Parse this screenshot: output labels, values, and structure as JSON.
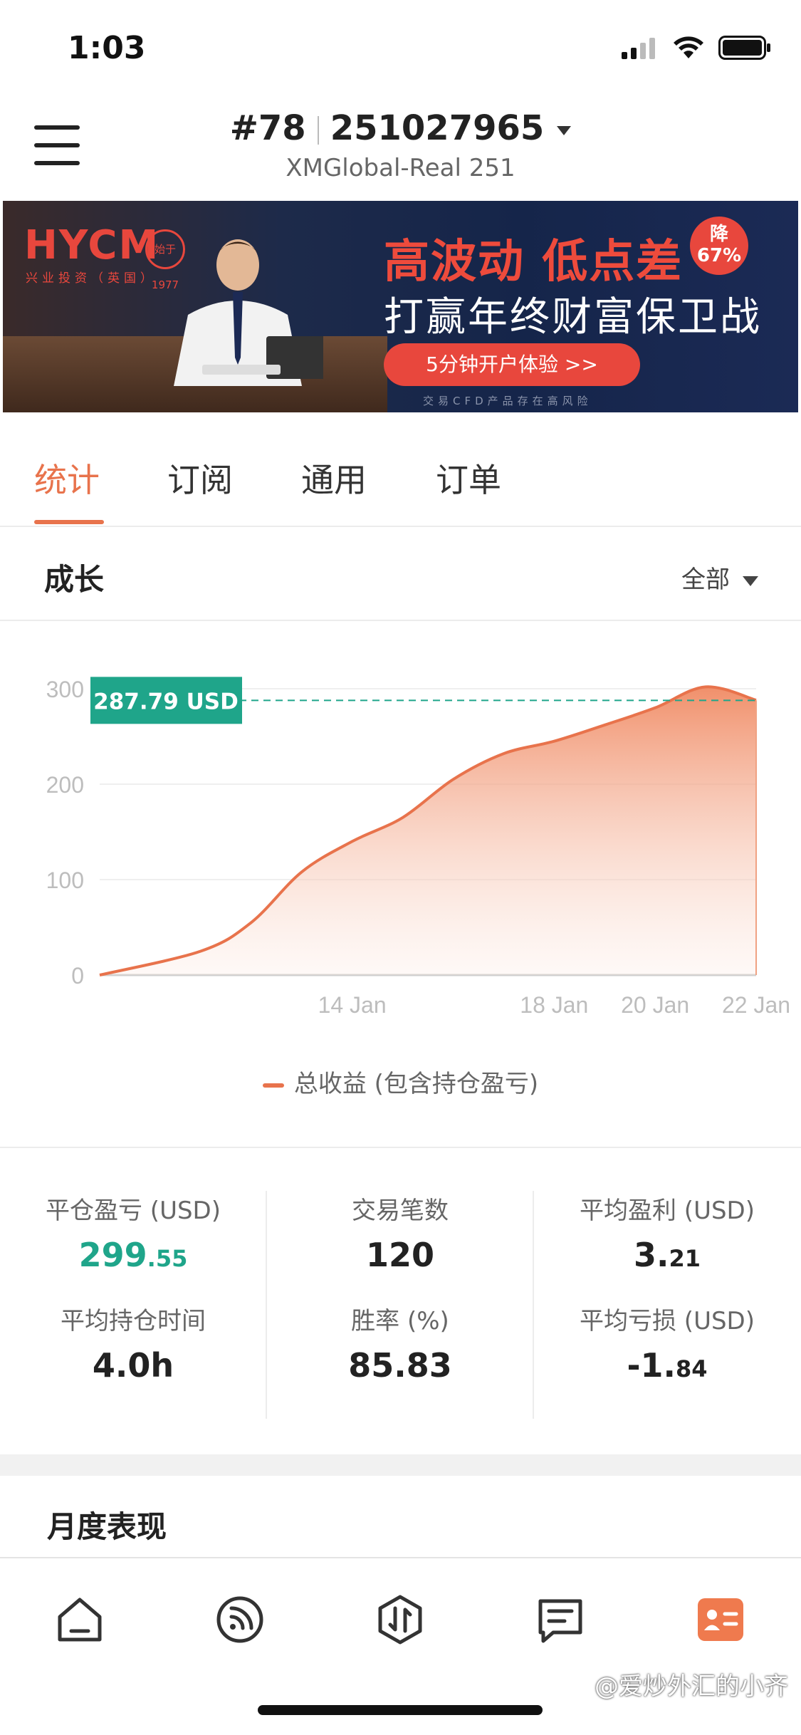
{
  "status_bar": {
    "time": "1:03"
  },
  "header": {
    "account_rank": "#78",
    "account_number": "251027965",
    "server": "XMGlobal-Real 251"
  },
  "banner": {
    "logo": "HYCM",
    "logo_sub": "兴业投资（英国）",
    "seal": "始于1977",
    "headline": "高波动 低点差",
    "subline": "打赢年终财富保卫战",
    "badge_line1": "降",
    "badge_line2": "67%",
    "cta": "5分钟开户体验 >>",
    "disclaimer": "交易CFD产品存在高风险"
  },
  "tabs": [
    {
      "label": "统计",
      "active": true
    },
    {
      "label": "订阅",
      "active": false
    },
    {
      "label": "通用",
      "active": false
    },
    {
      "label": "订单",
      "active": false
    }
  ],
  "growth": {
    "title": "成长",
    "range_filter": "全部"
  },
  "chart_data": {
    "type": "area",
    "x": [
      "2020-01-09",
      "2020-01-11",
      "2020-01-12",
      "2020-01-13",
      "2020-01-14",
      "2020-01-15",
      "2020-01-16",
      "2020-01-17",
      "2020-01-18",
      "2020-01-19",
      "2020-01-20",
      "2020-01-21",
      "2020-01-22"
    ],
    "series": [
      {
        "name": "总收益 (包含持仓盈亏)",
        "values": [
          0,
          25,
          55,
          108,
          140,
          165,
          205,
          232,
          245,
          262,
          280,
          302,
          288
        ]
      }
    ],
    "xticks": [
      "14 Jan",
      "18 Jan",
      "20 Jan",
      "22 Jan"
    ],
    "yticks": [
      0,
      100,
      200,
      300
    ],
    "ylim": [
      0,
      300
    ],
    "current_value_label": "287.79 USD",
    "current_value": 287.79,
    "grid": true,
    "color": "#e8734c",
    "marker_color": "#1fa58a"
  },
  "stats": [
    {
      "label": "平仓盈亏 (USD)",
      "int": "299",
      "dec": ".55",
      "highlight": true
    },
    {
      "label": "交易笔数",
      "int": "120",
      "dec": "",
      "highlight": false
    },
    {
      "label": "平均盈利 (USD)",
      "int": "3.",
      "dec": "21",
      "highlight": false
    },
    {
      "label": "平均持仓时间",
      "int": "4.0h",
      "dec": "",
      "highlight": false
    },
    {
      "label": "胜率 (%)",
      "int": "85.83",
      "dec": "",
      "highlight": false
    },
    {
      "label": "平均亏损 (USD)",
      "int": "-1.",
      "dec": "84",
      "highlight": false
    }
  ],
  "monthly": {
    "title": "月度表现"
  },
  "bottom_nav": [
    "home-icon",
    "feed-icon",
    "trade-icon",
    "news-icon",
    "profile-icon"
  ],
  "watermark": "@爱炒外汇的小齐"
}
